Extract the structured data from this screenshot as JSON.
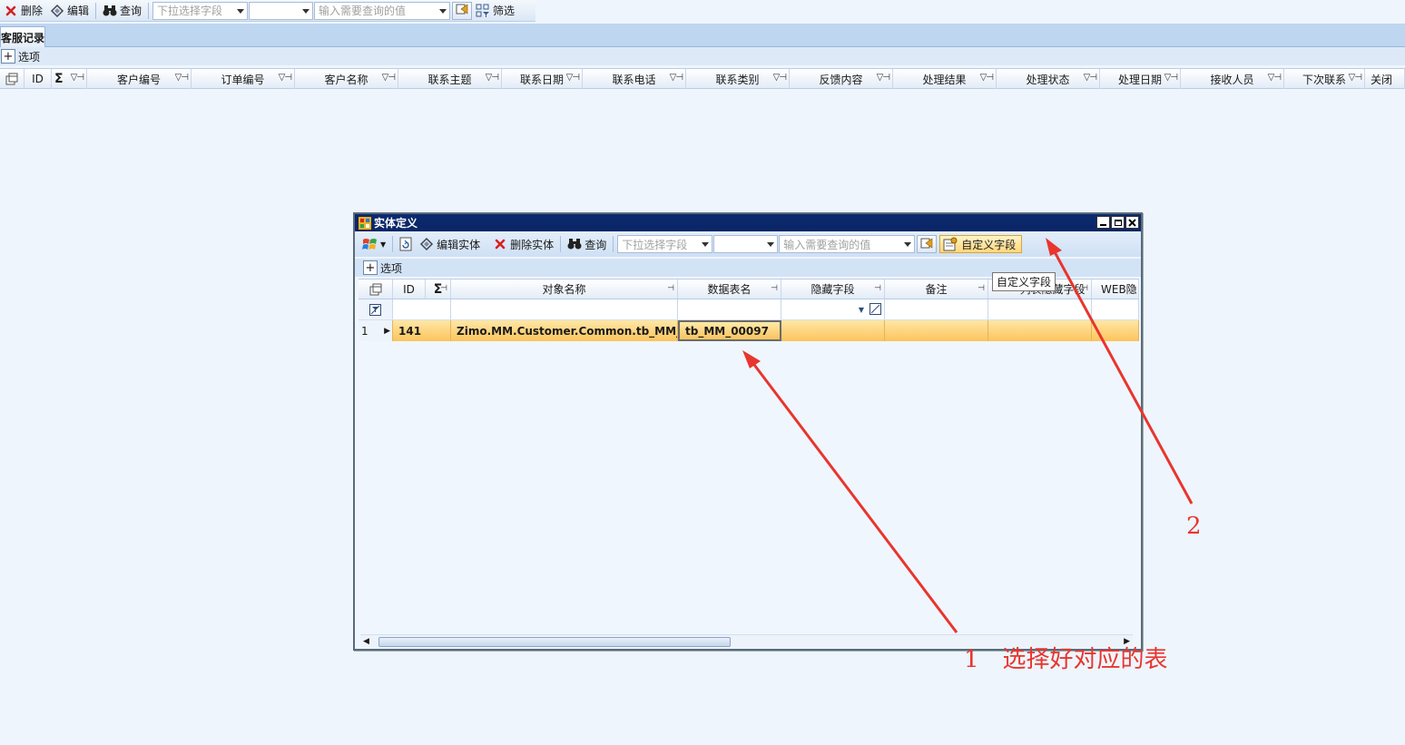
{
  "toolbar": {
    "delete_label": "删除",
    "edit_label": "编辑",
    "query_label": "查询",
    "field_placeholder": "下拉选择字段",
    "operator_value": "",
    "value_placeholder": "输入需要查询的值",
    "filter_label": "筛选"
  },
  "tab": {
    "label": "客服记录"
  },
  "options": {
    "label": "选项",
    "expand": "+"
  },
  "main_grid": {
    "columns": [
      "ID",
      "客户编号",
      "订单编号",
      "客户名称",
      "联系主题",
      "联系日期",
      "联系电话",
      "联系类别",
      "反馈内容",
      "处理结果",
      "处理状态",
      "处理日期",
      "接收人员",
      "下次联系",
      "关闭"
    ],
    "sigma": "Σ"
  },
  "dialog": {
    "title": "实体定义",
    "toolbar": {
      "edit_entity_label": "编辑实体",
      "delete_entity_label": "删除实体",
      "query_label": "查询",
      "field_placeholder": "下拉选择字段",
      "operator_value": "",
      "value_placeholder": "输入需要查询的值",
      "custom_field_label": "自定义字段"
    },
    "tooltip": "自定义字段",
    "options_label": "选项",
    "grid": {
      "columns": [
        "ID",
        "对象名称",
        "数据表名",
        "隐藏字段",
        "备注",
        "列表隐藏字段",
        "WEB隐"
      ],
      "rows": [
        {
          "num": "1",
          "id": "141",
          "object_name": "Zimo.MM.Customer.Common.tb_MM_客服",
          "table_name": "tb_MM_00097",
          "hidden": "",
          "remark": "",
          "list_hidden": "",
          "web_hidden": ""
        }
      ]
    }
  },
  "annotations": {
    "step1": "1　选择好对应的表",
    "step2": "2",
    "color": "#e8352e"
  },
  "colors": {
    "selected_row": "#fcc45c",
    "title_bar": "#0a2566",
    "background": "#eef5fc"
  }
}
